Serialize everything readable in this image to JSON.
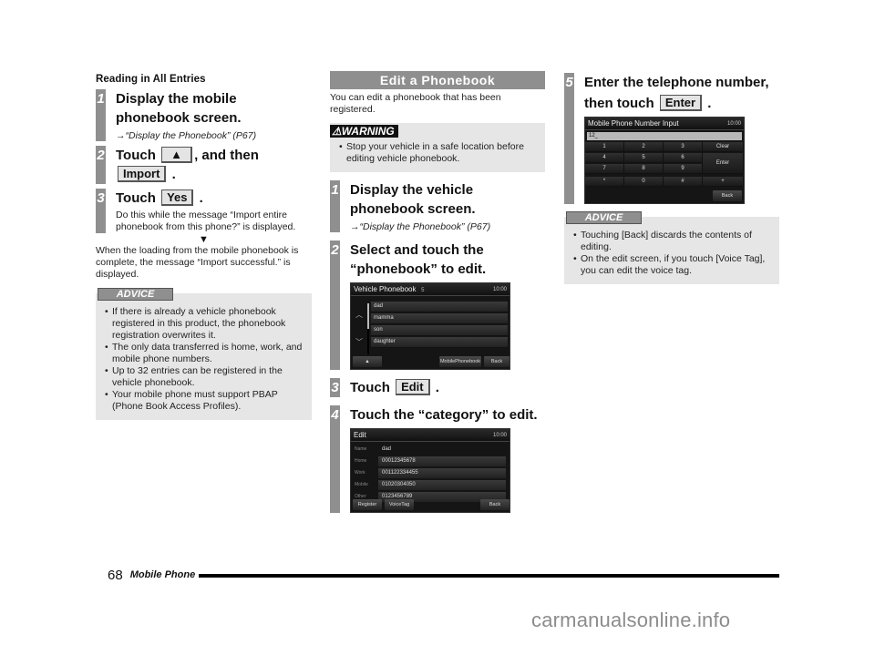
{
  "page": {
    "number": "68",
    "section": "Mobile Phone",
    "watermark": "carmanualsonline.info"
  },
  "col1": {
    "subhead": "Reading in All Entries",
    "steps": [
      {
        "num": "1",
        "title": "Display the mobile phonebook screen.",
        "ref": "→“Display the Phonebook” (P67)"
      },
      {
        "num": "2",
        "title_prefix": "Touch",
        "button1": "▲",
        "title_mid": ", and then",
        "button2": "Import",
        "title_suffix": "."
      },
      {
        "num": "3",
        "title_prefix": "Touch",
        "button1": "Yes",
        "title_suffix": ".",
        "body": "Do this while the message “Import entire phonebook from this phone?” is displayed."
      }
    ],
    "arrow": "▼",
    "result": "When the loading from the mobile phonebook is complete, the message “Import successful.” is displayed.",
    "advice": {
      "tag": "ADVICE",
      "items": [
        "If there is already a vehicle phonebook registered in this product, the phonebook registration overwrites it.",
        "The only data transferred is home, work, and mobile phone numbers.",
        "Up to 32 entries can be registered in the vehicle phonebook.",
        "Your mobile phone must support PBAP (Phone Book Access Profiles)."
      ]
    }
  },
  "col2": {
    "banner": "Edit a Phonebook",
    "intro": "You can edit a phonebook that has been registered.",
    "warning": {
      "tag": "⚠WARNING",
      "items": [
        "Stop your vehicle in a safe location before editing vehicle phonebook."
      ]
    },
    "steps": [
      {
        "num": "1",
        "title": "Display the vehicle phonebook screen.",
        "ref": "→“Display the Phonebook” (P67)"
      },
      {
        "num": "2",
        "title": "Select and touch the “phonebook” to edit."
      },
      {
        "num": "3",
        "title_prefix": "Touch",
        "button1": "Edit",
        "title_suffix": "."
      },
      {
        "num": "4",
        "title": "Touch the “category” to edit."
      }
    ],
    "screen_vehicle_phonebook": {
      "title": "Vehicle Phonebook",
      "count": "5",
      "clock": "10:00",
      "up": "︿",
      "down": "﹀",
      "entries": [
        "dad",
        "mamma",
        "son",
        "daughter"
      ],
      "buttons": {
        "up_arrow": "▲",
        "mobile_phonebook": "MobilePhonebook",
        "back": "Back"
      }
    },
    "screen_edit": {
      "title": "Edit",
      "clock": "10:00",
      "rows": [
        {
          "label": "Name",
          "value": "dad"
        },
        {
          "label": "Home",
          "value": "00012345678"
        },
        {
          "label": "Work",
          "value": "001122334455"
        },
        {
          "label": "Mobile",
          "value": "01020304050"
        },
        {
          "label": "Other",
          "value": "0123456789"
        }
      ],
      "buttons": {
        "register": "Register",
        "voice_tag": "VoiceTag",
        "back": "Back"
      }
    }
  },
  "col3": {
    "steps": [
      {
        "num": "5",
        "title_line1": "Enter the telephone number,",
        "title_prefix": "then touch",
        "button1": "Enter",
        "title_suffix": "."
      }
    ],
    "screen_number_input": {
      "title": "Mobile Phone Number Input",
      "clock": "10:00",
      "input_value": "12_",
      "keys": [
        "1",
        "2",
        "3",
        "4",
        "5",
        "6",
        "7",
        "8",
        "9",
        "*",
        "0",
        "#"
      ],
      "side": {
        "clear": "Clear",
        "enter": "Enter",
        "plus": "+",
        "back": "Back"
      }
    },
    "advice": {
      "tag": "ADVICE",
      "items": [
        "Touching [Back] discards the contents of editing.",
        "On the edit screen, if you touch [Voice Tag], you can edit the voice tag."
      ]
    }
  }
}
